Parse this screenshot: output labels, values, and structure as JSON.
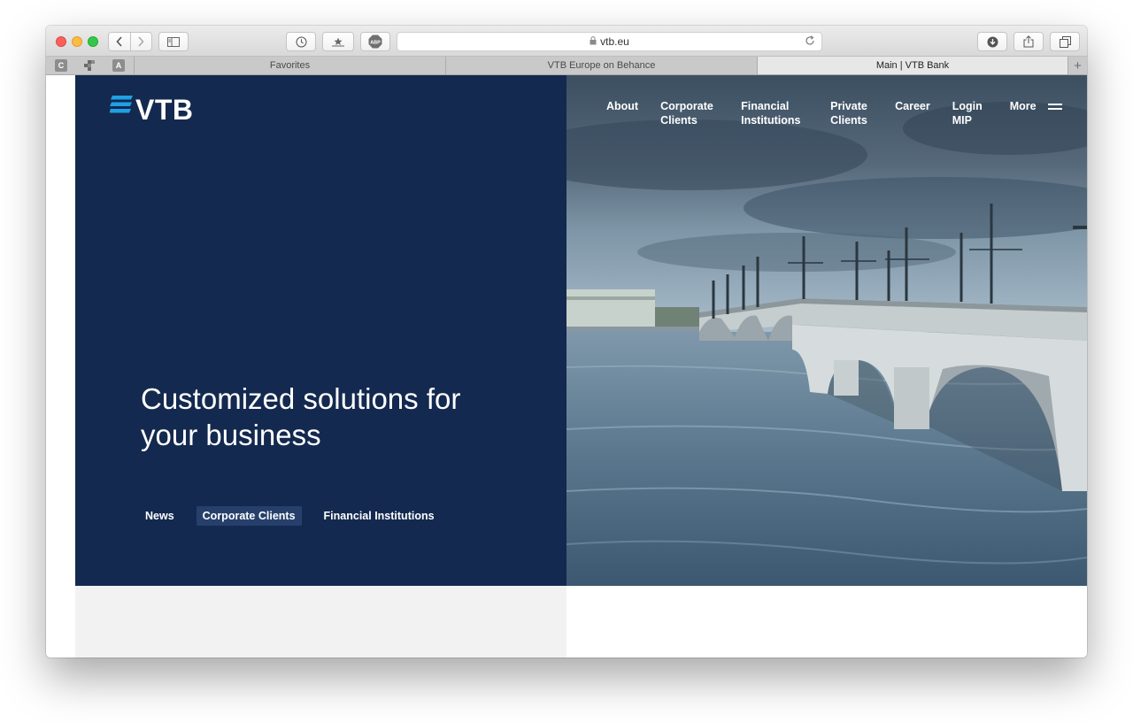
{
  "browser": {
    "url": "vtb.eu",
    "pinned_tabs": [
      "C",
      "A"
    ],
    "tabs": [
      {
        "label": "Favorites",
        "active": false
      },
      {
        "label": "VTB Europe on Behance",
        "active": false
      },
      {
        "label": "Main | VTB Bank",
        "active": true
      }
    ],
    "new_tab_label": "+"
  },
  "site": {
    "logo_text": "VTB",
    "nav": [
      "About",
      "Corporate Clients",
      "Financial Institutions",
      "Private Clients",
      "Career",
      "Login MIP",
      "More"
    ],
    "headline": "Customized solutions for your business",
    "hero_tabs": [
      "News",
      "Corporate Clients",
      "Financial Institutions"
    ],
    "active_hero_tab": "Corporate Clients"
  },
  "colors": {
    "brand_navy": "#14294f",
    "brand_blue": "#1fa0e6",
    "active_tab_bg": "#26406b"
  }
}
